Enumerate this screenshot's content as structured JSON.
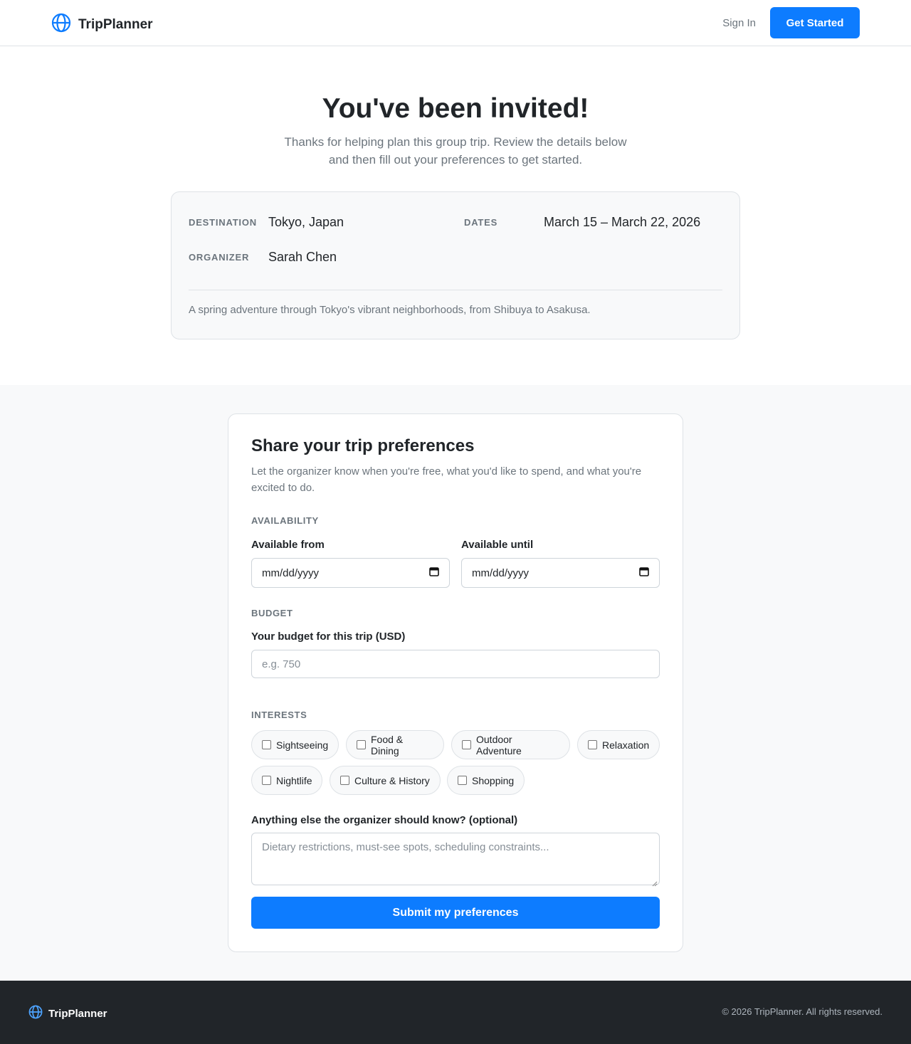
{
  "header": {
    "brand": "TripPlanner",
    "sign_in": "Sign In",
    "get_started": "Get Started"
  },
  "hero": {
    "title": "You've been invited!",
    "subtitle": "Thanks for helping plan this group trip. Review the details below and then fill out your preferences to get started."
  },
  "trip": {
    "destination_label": "Destination",
    "destination": "Tokyo, Japan",
    "dates_label": "Dates",
    "dates": "March 15 – March 22, 2026",
    "organizer_label": "Organizer",
    "organizer": "Sarah Chen",
    "description": "A spring adventure through Tokyo's vibrant neighborhoods, from Shibuya to Asakusa."
  },
  "form": {
    "title": "Share your trip preferences",
    "subtitle": "Let the organizer know when you're free, what you'd like to spend, and what you're excited to do.",
    "availability_section": "Availability",
    "available_from_label": "Available from",
    "available_from_value": "mm/dd/yyyy",
    "available_until_label": "Available until",
    "available_until_value": "mm/dd/yyyy",
    "budget_section": "Budget",
    "budget_label": "Your budget for this trip (USD)",
    "budget_placeholder": "e.g. 750",
    "interests_section": "Interests",
    "interests": [
      {
        "label": "Sightseeing",
        "checked": false
      },
      {
        "label": "Food & Dining",
        "checked": false
      },
      {
        "label": "Outdoor Adventure",
        "checked": false
      },
      {
        "label": "Relaxation",
        "checked": false
      },
      {
        "label": "Nightlife",
        "checked": false
      },
      {
        "label": "Culture & History",
        "checked": false
      },
      {
        "label": "Shopping",
        "checked": false
      }
    ],
    "notes_label": "Anything else the organizer should know? (optional)",
    "notes_placeholder": "Dietary restrictions, must-see spots, scheduling constraints...",
    "submit": "Submit my preferences"
  },
  "footer": {
    "brand": "TripPlanner",
    "copyright": "© 2026 TripPlanner. All rights reserved."
  },
  "colors": {
    "accent": "#0d7cff",
    "footer_bg": "#212529",
    "muted_text": "#6c757d"
  }
}
